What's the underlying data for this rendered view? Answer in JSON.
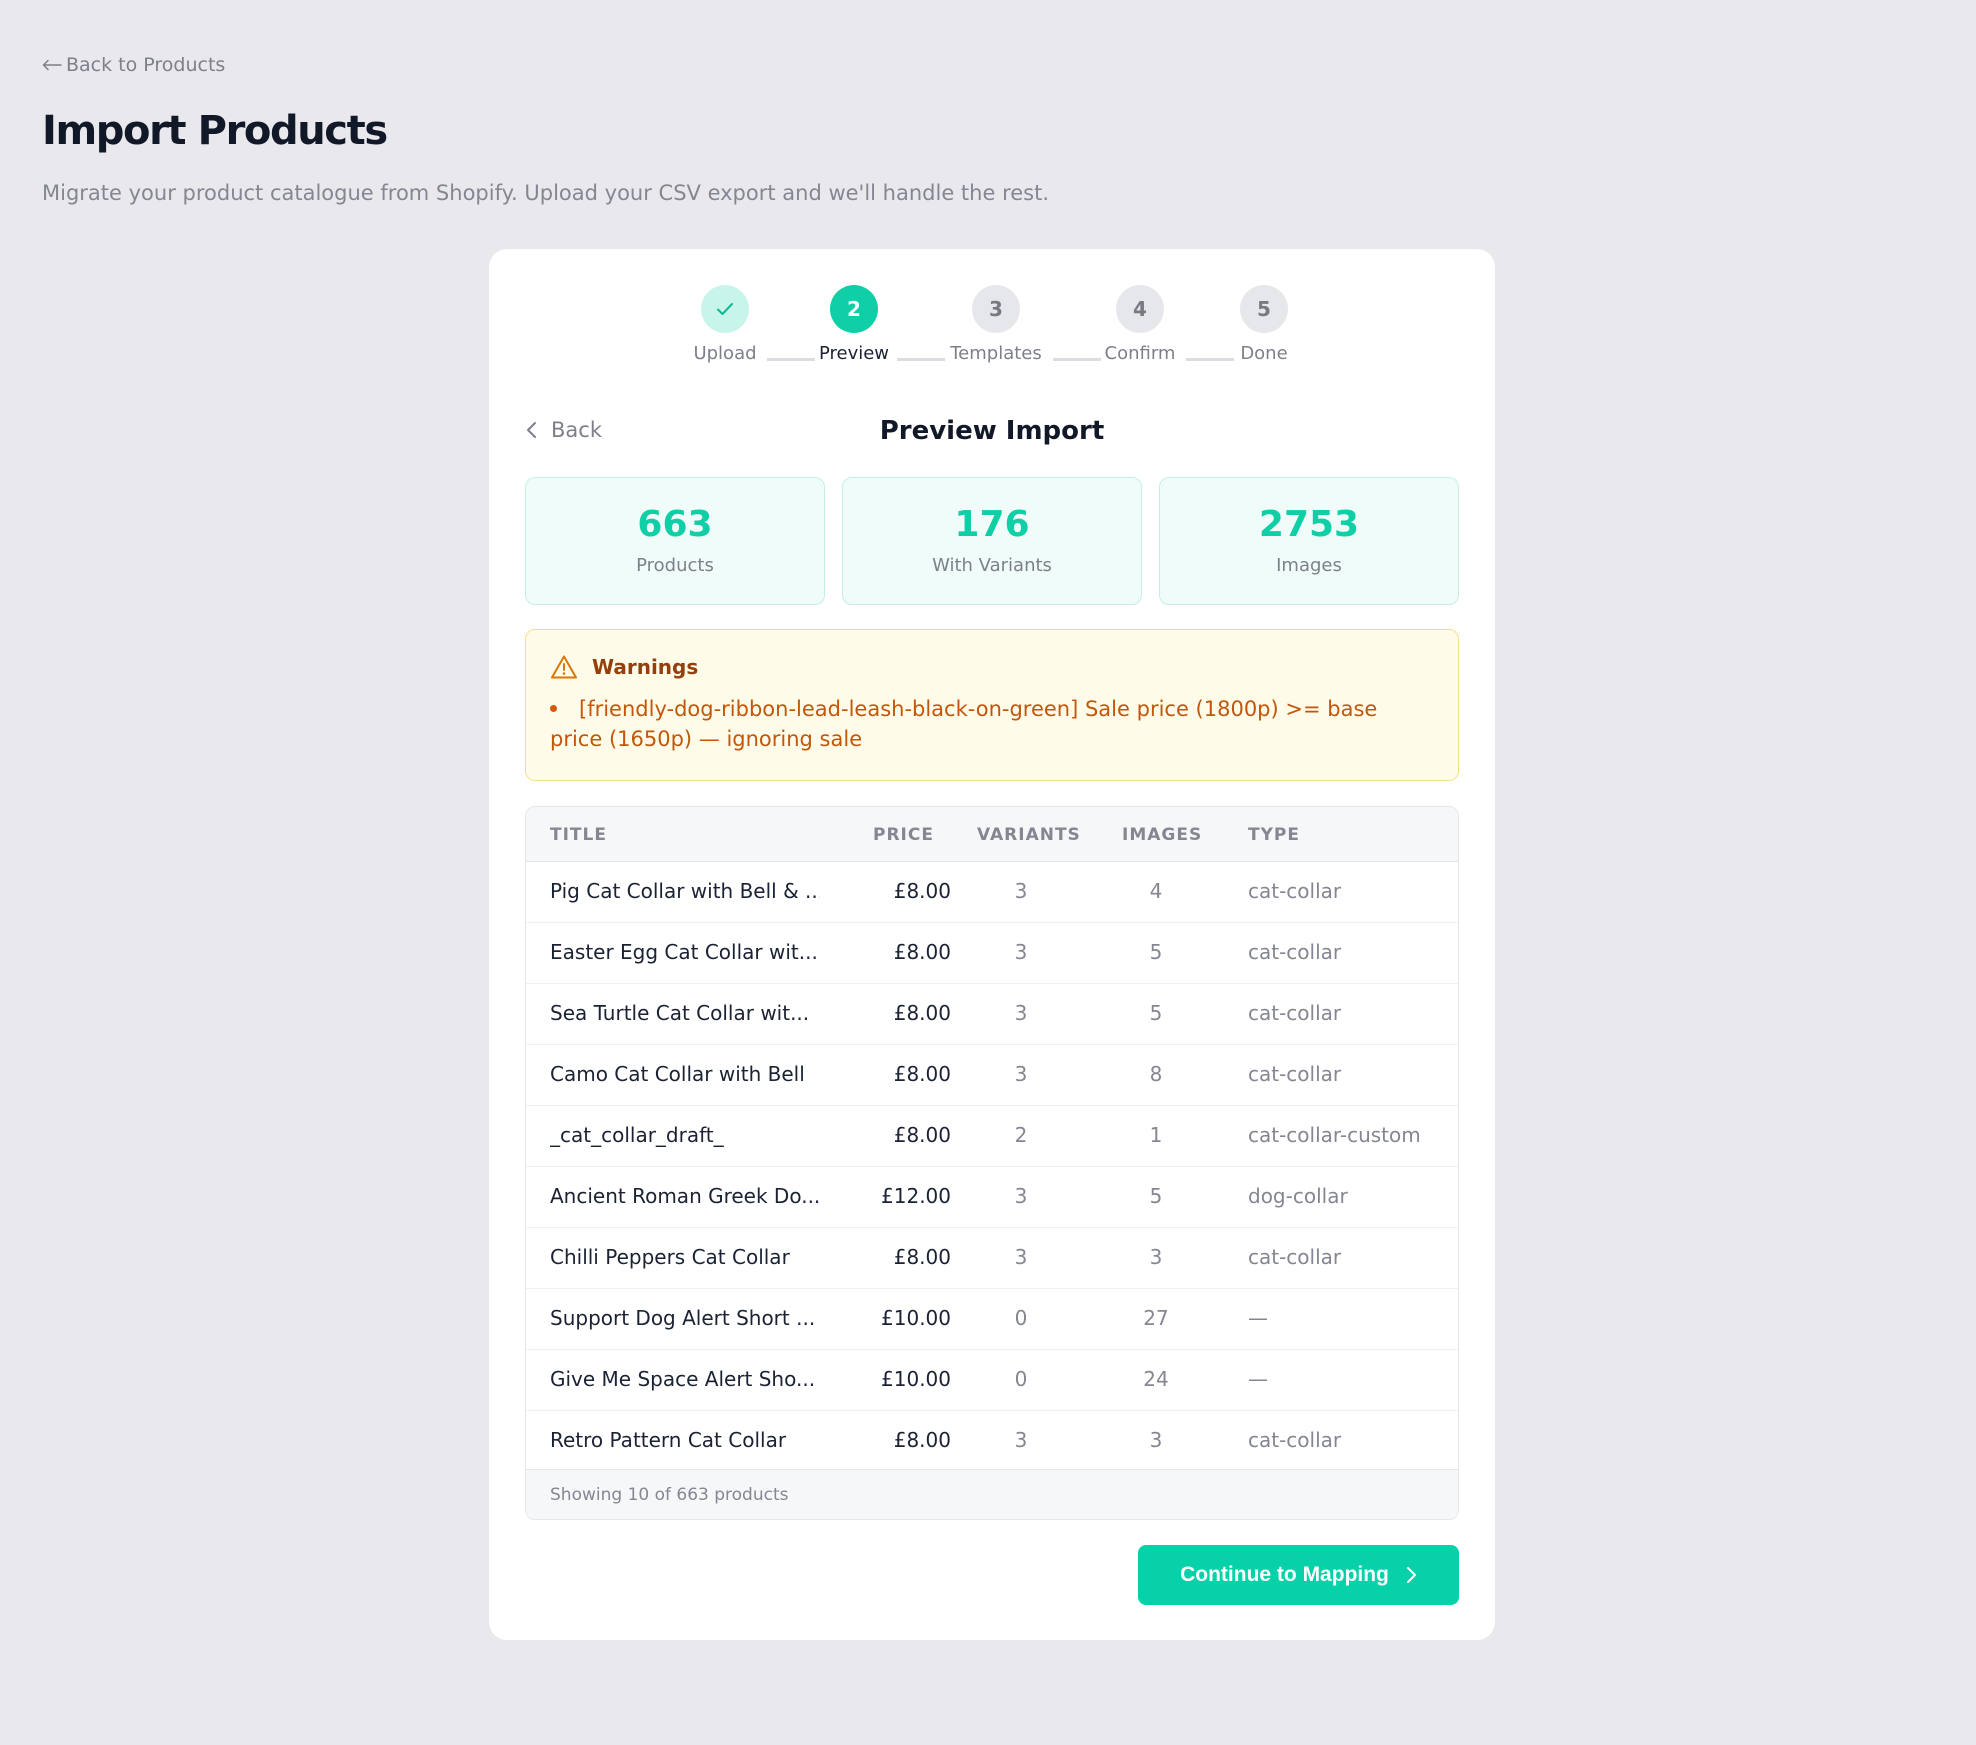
{
  "page": {
    "back_link": "Back to Products",
    "title": "Import Products",
    "subtitle": "Migrate your product catalogue from Shopify. Upload your CSV export and we'll handle the rest."
  },
  "stepper": {
    "steps": [
      {
        "number": "",
        "label": "Upload",
        "state": "done",
        "icon": "check-icon"
      },
      {
        "number": "2",
        "label": "Preview",
        "state": "active"
      },
      {
        "number": "3",
        "label": "Templates",
        "state": "pending"
      },
      {
        "number": "4",
        "label": "Confirm",
        "state": "pending"
      },
      {
        "number": "5",
        "label": "Done",
        "state": "pending"
      }
    ]
  },
  "card": {
    "back_label": "Back",
    "title": "Preview Import"
  },
  "stats": [
    {
      "value": "663",
      "label": "Products"
    },
    {
      "value": "176",
      "label": "With Variants"
    },
    {
      "value": "2753",
      "label": "Images"
    }
  ],
  "warnings": {
    "title": "Warnings",
    "items": [
      "[friendly-dog-ribbon-lead-leash-black-on-green] Sale price (1800p) >= base price (1650p) — ignoring sale"
    ]
  },
  "table": {
    "headers": {
      "title": "TITLE",
      "price": "PRICE",
      "variants": "VARIANTS",
      "images": "IMAGES",
      "type": "TYPE"
    },
    "rows": [
      {
        "title": "Pig Cat Collar with Bell & ...",
        "price": "£8.00",
        "variants": "3",
        "images": "4",
        "type": "cat-collar"
      },
      {
        "title": "Easter Egg Cat Collar wit...",
        "price": "£8.00",
        "variants": "3",
        "images": "5",
        "type": "cat-collar"
      },
      {
        "title": "Sea Turtle Cat Collar wit...",
        "price": "£8.00",
        "variants": "3",
        "images": "5",
        "type": "cat-collar"
      },
      {
        "title": "Camo Cat Collar with Bell",
        "price": "£8.00",
        "variants": "3",
        "images": "8",
        "type": "cat-collar"
      },
      {
        "title": "_cat_collar_draft_",
        "price": "£8.00",
        "variants": "2",
        "images": "1",
        "type": "cat-collar-custom"
      },
      {
        "title": "Ancient Roman Greek Do...",
        "price": "£12.00",
        "variants": "3",
        "images": "5",
        "type": "dog-collar"
      },
      {
        "title": "Chilli Peppers Cat Collar",
        "price": "£8.00",
        "variants": "3",
        "images": "3",
        "type": "cat-collar"
      },
      {
        "title": "Support Dog Alert Short ...",
        "price": "£10.00",
        "variants": "0",
        "images": "27",
        "type": "—"
      },
      {
        "title": "Give Me Space Alert Sho...",
        "price": "£10.00",
        "variants": "0",
        "images": "24",
        "type": "—"
      },
      {
        "title": "Retro Pattern Cat Collar",
        "price": "£8.00",
        "variants": "3",
        "images": "3",
        "type": "cat-collar"
      }
    ],
    "footer": "Showing 10 of 663 products"
  },
  "actions": {
    "continue_label": "Continue to Mapping"
  },
  "colors": {
    "accent": "#0fcfa6",
    "warning_bg": "#fefbe9",
    "warning_text": "#c2570c",
    "background": "#e9e9ed"
  }
}
